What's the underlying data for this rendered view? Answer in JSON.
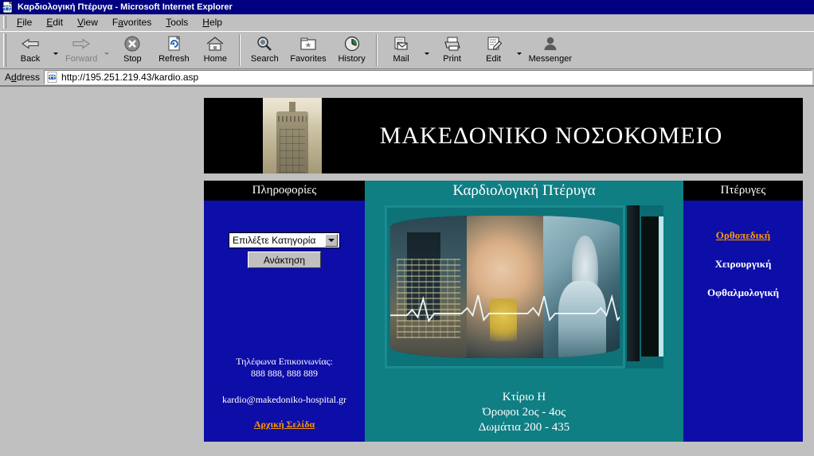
{
  "window": {
    "title": "Καρδιολογική Πτέρυγα - Microsoft Internet Explorer",
    "icon": "ie-document-icon"
  },
  "menubar": {
    "items": [
      {
        "label": "File",
        "accel": "F"
      },
      {
        "label": "Edit",
        "accel": "E"
      },
      {
        "label": "View",
        "accel": "V"
      },
      {
        "label": "Favorites",
        "accel": "a"
      },
      {
        "label": "Tools",
        "accel": "T"
      },
      {
        "label": "Help",
        "accel": "H"
      }
    ]
  },
  "toolbar": {
    "back": "Back",
    "forward": "Forward",
    "stop": "Stop",
    "refresh": "Refresh",
    "home": "Home",
    "search": "Search",
    "favorites": "Favorites",
    "history": "History",
    "mail": "Mail",
    "print": "Print",
    "edit": "Edit",
    "messenger": "Messenger"
  },
  "address": {
    "label": "Address",
    "url": "http://195.251.219.43/kardio.asp"
  },
  "page": {
    "banner": {
      "title": "ΜΑΚΕΔΟΝΙΚΟ ΝΟΣΟΚΟΜΕΙΟ",
      "photo_alt": "white-tower-thessaloniki"
    },
    "left": {
      "header": "Πληροφορίες",
      "select_value": "Επιλέξτε Κατηγορία",
      "submit_label": "Ανάκτηση",
      "phone_label": "Τηλέφωνα Επικοινωνίας:",
      "phone_numbers": "888 888, 888 889",
      "email": "kardio@makedoniko-hospital.gr",
      "home_link": "Αρχική Σελίδα"
    },
    "center": {
      "header": "Καρδιολογική Πτέρυγα",
      "image_alt": "hospital-medical-montage-ecg",
      "building": "Κτίριο Η",
      "floors": "Όροφοι 2ος - 4ος",
      "rooms": "Δωμάτια 200 - 435"
    },
    "right": {
      "header": "Πτέρυγες",
      "wards": [
        {
          "label": "Ορθοπεδική",
          "is_link": true
        },
        {
          "label": "Χειρουργική",
          "is_link": false
        },
        {
          "label": "Οφθαλμολογική",
          "is_link": false
        }
      ]
    }
  },
  "colors": {
    "titlebar": "#000080",
    "chrome": "#c0c0c0",
    "sidebar_blue": "#0D0DA8",
    "center_teal": "#0F7F84",
    "header_black": "#000000",
    "link_orange": "#FF9900"
  }
}
